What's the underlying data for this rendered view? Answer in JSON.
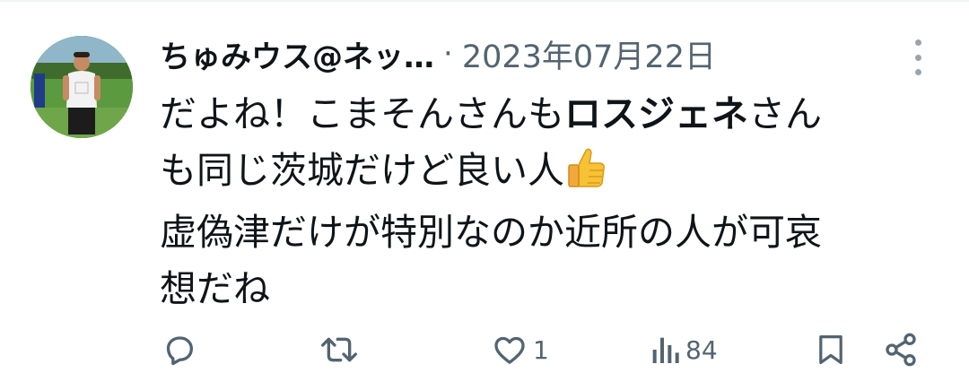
{
  "tweet": {
    "author": "ちゅみウス@ネッ…",
    "separator": "·",
    "date": "2023年07月22日",
    "body": {
      "line1_a": "だよね！こまそんさんも",
      "line1_b": "ロスジェネ",
      "line1_c": "さん",
      "line2": "も同じ茨城だけど良い人",
      "line2_emoji": "thumbs-up-emoji",
      "line3": "虚偽津だけが特別なのか近所の人が可哀",
      "line4": "想だね"
    }
  },
  "actions": {
    "reply_icon": "reply-icon",
    "retweet_icon": "retweet-icon",
    "like_icon": "heart-icon",
    "like_count": "1",
    "views_icon": "views-icon",
    "views_count": "84",
    "bookmark_icon": "bookmark-icon",
    "share_icon": "share-icon"
  },
  "colors": {
    "text": "#0f1419",
    "muted": "#536471",
    "divider": "#eff3f4"
  }
}
